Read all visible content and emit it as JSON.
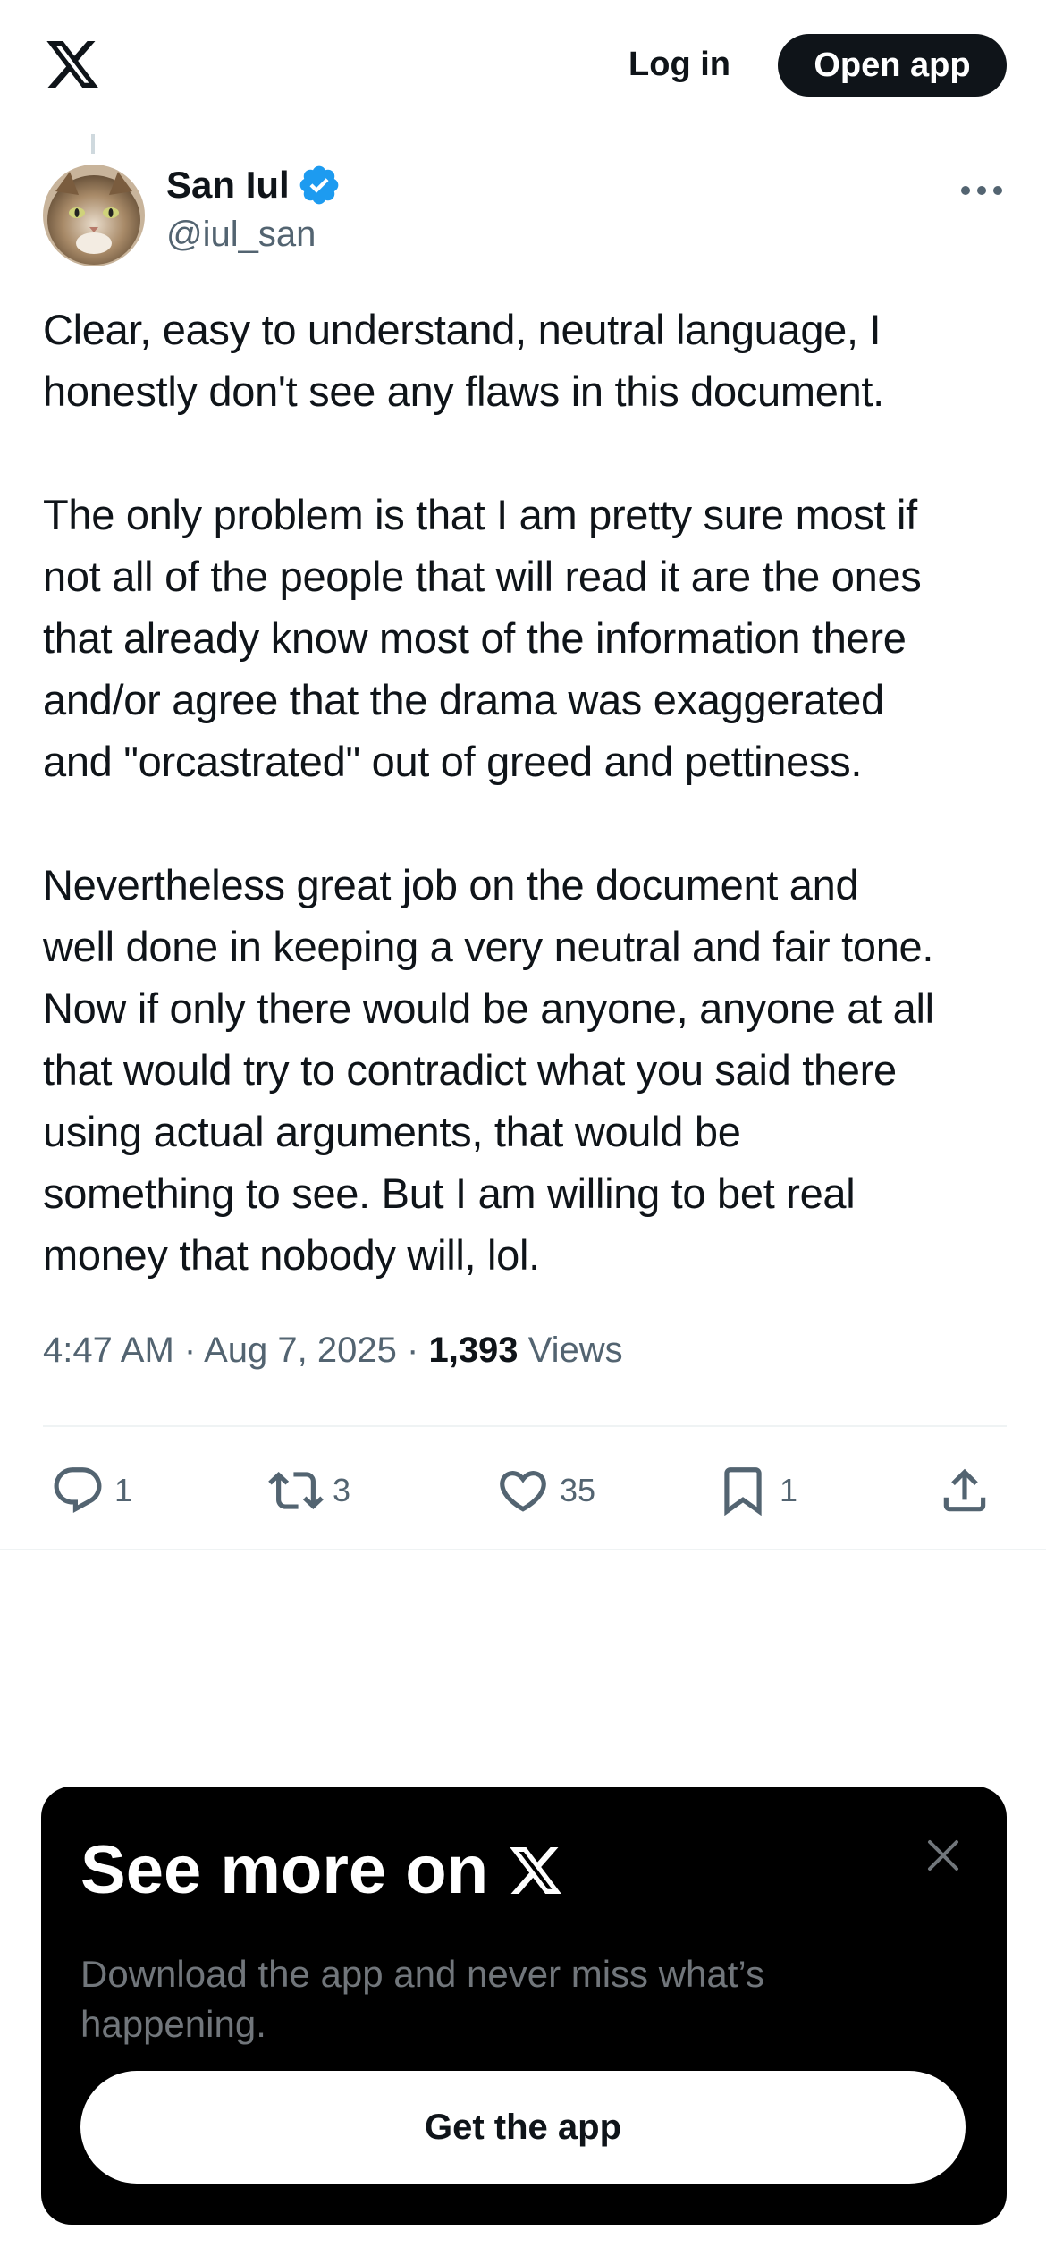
{
  "header": {
    "logo_icon": "x-logo-icon",
    "login_label": "Log in",
    "open_app_label": "Open app"
  },
  "tweet": {
    "author": {
      "name": "San Iul",
      "handle": "@iul_san",
      "verified": true,
      "avatar_icon": "cat-avatar"
    },
    "text": "Clear, easy to understand, neutral language, I\nhonestly don't see any flaws in this document.\n\nThe only problem is that I am pretty sure most if\nnot all of the people that will read it are the ones\nthat already know most of the information there\nand/or agree that the drama was exaggerated\nand \"orcastrated\" out of greed and pettiness.\n\nNevertheless great job on the document and\nwell done in keeping a very neutral and fair tone.\nNow if only there would be anyone, anyone at all\nthat would try to contradict what you said there\nusing actual arguments, that would be\nsomething to see. But I am willing to bet real\nmoney that nobody will, lol.",
    "time": "4:47 AM",
    "date": "Aug 7, 2025",
    "separator": "·",
    "views_count": "1,393",
    "views_label": "Views",
    "actions": {
      "reply": {
        "icon": "reply-icon",
        "count": "1"
      },
      "retweet": {
        "icon": "retweet-icon",
        "count": "3"
      },
      "like": {
        "icon": "heart-icon",
        "count": "35"
      },
      "bookmark": {
        "icon": "bookmark-icon",
        "count": "1"
      },
      "share": {
        "icon": "share-icon"
      }
    }
  },
  "promo": {
    "title": "See more on",
    "subtitle": "Download the app and never miss what’s happening.",
    "button_label": "Get the app",
    "close_icon": "close-icon"
  },
  "colors": {
    "text_primary": "#0f1419",
    "text_secondary": "#536471",
    "verified_blue": "#1d9bf0",
    "divider": "#eff3f4",
    "promo_bg": "#000000"
  }
}
